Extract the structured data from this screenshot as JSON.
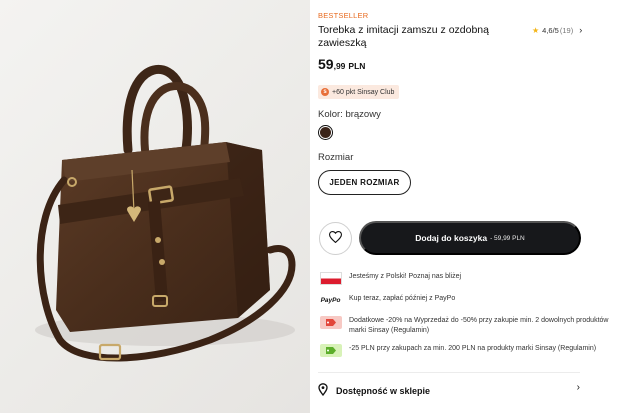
{
  "product": {
    "badge": "BESTSELLER",
    "title": "Torebka z imitacji zamszu z ozdobną zawieszką",
    "rating": "4,6/5",
    "rating_count": "(19)",
    "price_main": "59",
    "price_decimals": ",99",
    "currency": "PLN",
    "club_points": "+60 pkt Sinsay Club",
    "color_label": "Kolor: brązowy",
    "color_hex": "#3b2419",
    "size_label": "Rozmiar",
    "size_option": "JEDEN ROZMIAR"
  },
  "actions": {
    "add_to_cart": "Dodaj do koszyka",
    "add_to_cart_price": "- 59,99 PLN",
    "favorite_icon": "heart-icon"
  },
  "perks": [
    {
      "icon": "poland-flag-icon",
      "text": "Jesteśmy z Polski! Poznaj nas bliżej"
    },
    {
      "icon": "paypo-logo",
      "logo_text": "PayPo",
      "text": "Kup teraz, zapłać później z PayPo"
    },
    {
      "icon": "discount-tag-icon",
      "text": "Dodatkowe -20% na Wyprzedaż do -50% przy zakupie min. 2 dowolnych produktów marki Sinsay (Regulamin)"
    },
    {
      "icon": "discount-tag-icon",
      "text": "-25 PLN przy zakupach za min. 200 PLN na produkty marki Sinsay (Regulamin)"
    }
  ],
  "availability": {
    "label": "Dostępność w sklepie"
  },
  "colors": {
    "accent_orange": "#e86a1f",
    "button_dark": "#17181b",
    "star": "#f3b416"
  }
}
